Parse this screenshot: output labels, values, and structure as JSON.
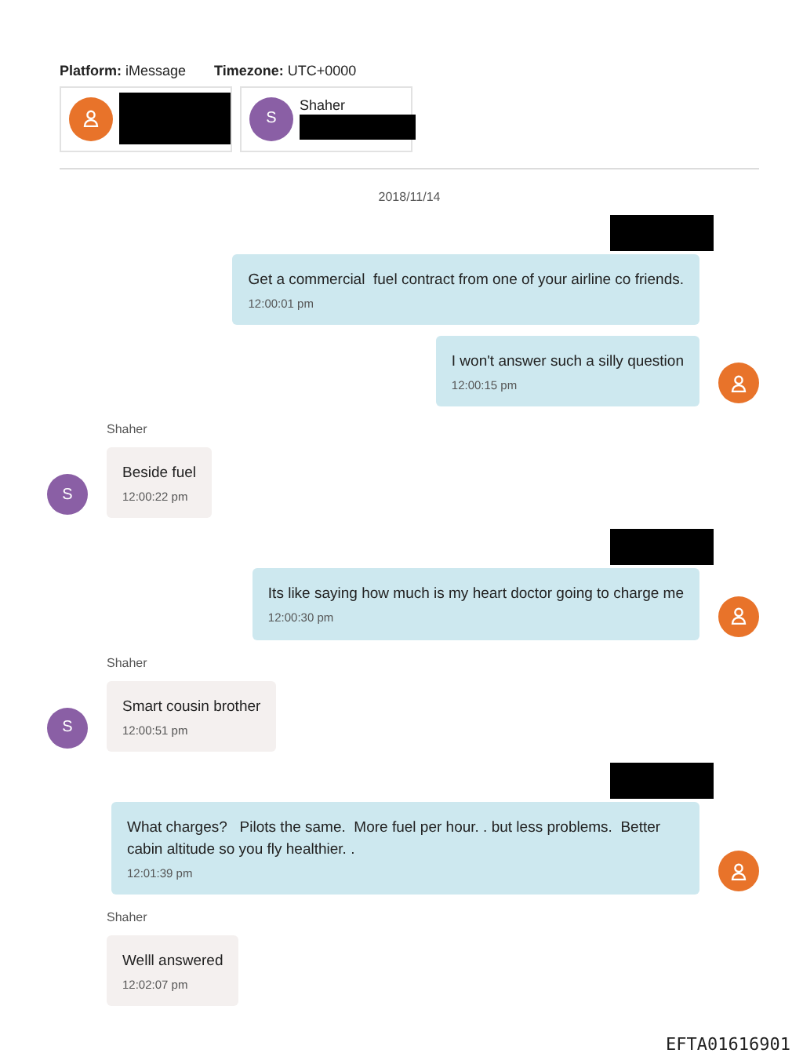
{
  "header": {
    "platform_label": "Platform:",
    "platform": "iMessage",
    "timezone_label": "Timezone:",
    "timezone": "UTC+0000"
  },
  "participants": [
    {
      "kind": "person",
      "name_redacted": true,
      "color": "#e8732a"
    },
    {
      "kind": "initial",
      "initial": "S",
      "name": "Shaher",
      "name_redacted": true,
      "color": "#8a5fa5"
    }
  ],
  "date": "2018/11/14",
  "messages": [
    {
      "kind": "outgoing",
      "sender_redacted": true,
      "show_avatar": false,
      "text": "Get a commercial  fuel contract from one of your airline co friends.",
      "time": "12:00:01 pm"
    },
    {
      "kind": "outgoing",
      "sender_redacted": false,
      "show_avatar": true,
      "text": "I won't answer such a silly question",
      "time": "12:00:15 pm"
    },
    {
      "kind": "incoming",
      "sender": "Shaher",
      "avatar_initial": "S",
      "show_avatar": true,
      "text": "Beside fuel",
      "time": "12:00:22 pm"
    },
    {
      "kind": "outgoing",
      "sender_redacted": true,
      "show_avatar": true,
      "text": "Its like saying how much is my heart doctor going to charge me",
      "time": "12:00:30 pm"
    },
    {
      "kind": "incoming",
      "sender": "Shaher",
      "avatar_initial": "S",
      "show_avatar": true,
      "text": "Smart cousin brother",
      "time": "12:00:51 pm"
    },
    {
      "kind": "outgoing",
      "sender_redacted": true,
      "show_avatar": true,
      "text": "What charges?   Pilots the same.  More fuel per hour. . but less problems.  Better cabin altitude so you fly healthier. .",
      "time": "12:01:39 pm"
    },
    {
      "kind": "incoming",
      "sender": "Shaher",
      "show_avatar": false,
      "text": "Welll answered",
      "time": "12:02:07 pm"
    }
  ],
  "document_id": "EFTA01616901"
}
